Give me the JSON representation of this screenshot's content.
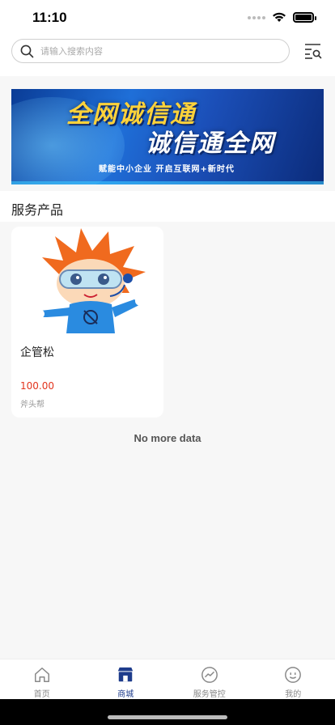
{
  "status": {
    "time": "11:10"
  },
  "search": {
    "placeholder": "请输入搜索内容"
  },
  "banner": {
    "line1": "全网诚信通",
    "line2": "诚信通全网",
    "subtitle": "赋能中小企业 开启互联网+新时代"
  },
  "section": {
    "title": "服务产品"
  },
  "products": [
    {
      "name": "企管松",
      "price": "100.00",
      "shop": "斧头帮"
    }
  ],
  "list": {
    "end_text": "No more data"
  },
  "tabbar": {
    "items": [
      {
        "label": "首页",
        "icon": "home-icon",
        "active": false
      },
      {
        "label": "商城",
        "icon": "store-icon",
        "active": true
      },
      {
        "label": "服务管控",
        "icon": "chart-icon",
        "active": false
      },
      {
        "label": "我的",
        "icon": "smile-icon",
        "active": false
      }
    ]
  },
  "colors": {
    "accent": "#1e3c8c",
    "price": "#e2341d"
  }
}
